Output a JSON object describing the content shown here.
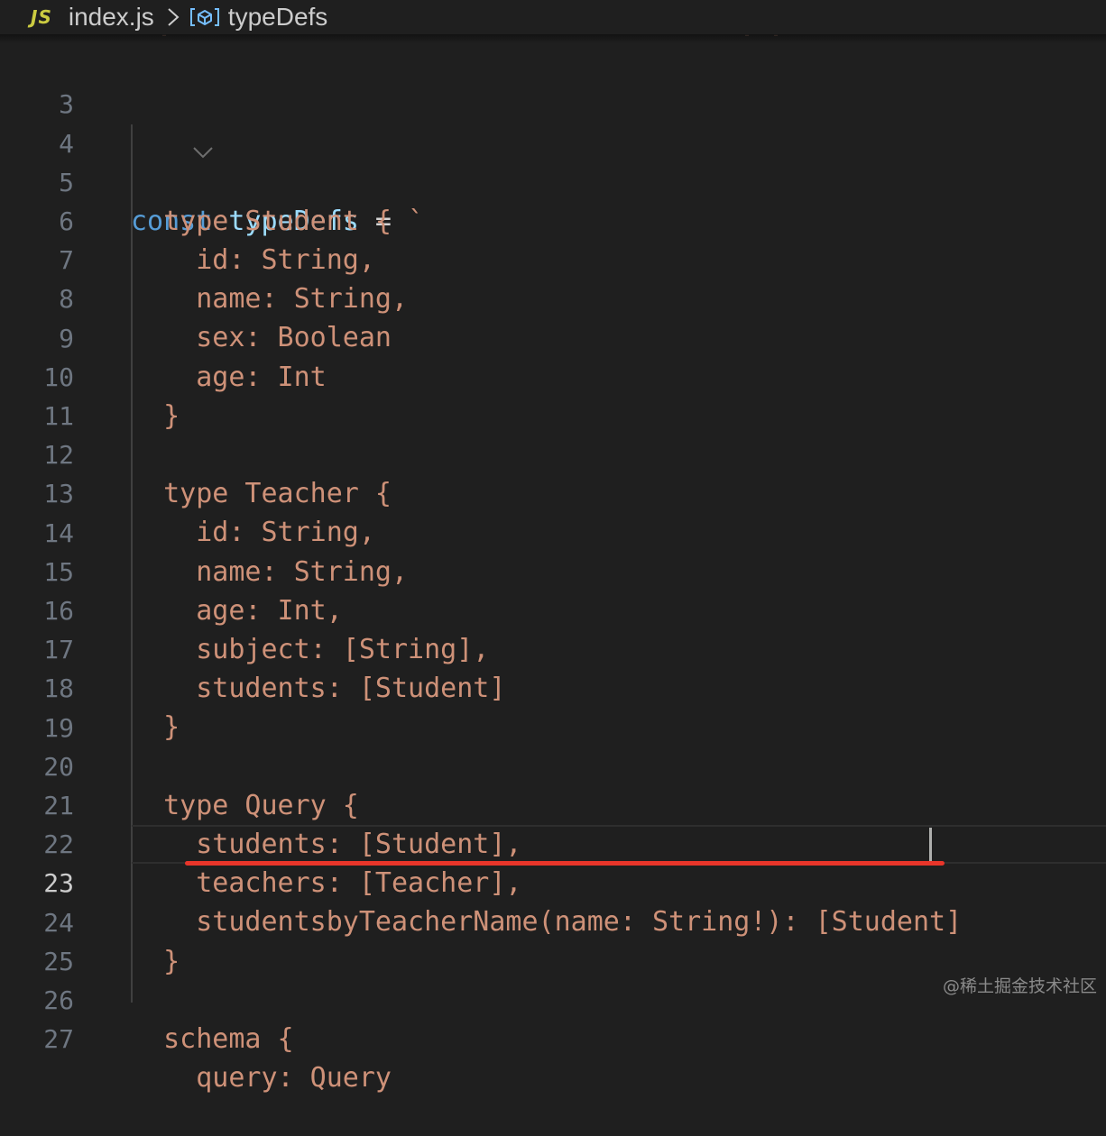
{
  "breadcrumb": {
    "file_badge": "JS",
    "file_name": "index.js",
    "symbol": "typeDefs",
    "chevron_icon": "chevron-right-icon",
    "symbol_icon": "variable-symbol-icon"
  },
  "editor": {
    "active_line": 23,
    "lines": [
      {
        "num": "3",
        "text": ""
      },
      {
        "num": "4",
        "kw": "const",
        "ident": "typeDefs",
        "op": " = ",
        "str": "`"
      },
      {
        "num": "5",
        "text": "  type Student {"
      },
      {
        "num": "6",
        "text": "    id: String,"
      },
      {
        "num": "7",
        "text": "    name: String,"
      },
      {
        "num": "8",
        "text": "    sex: Boolean"
      },
      {
        "num": "9",
        "text": "    age: Int"
      },
      {
        "num": "10",
        "text": "  }"
      },
      {
        "num": "11",
        "text": ""
      },
      {
        "num": "12",
        "text": "  type Teacher {"
      },
      {
        "num": "13",
        "text": "    id: String,"
      },
      {
        "num": "14",
        "text": "    name: String,"
      },
      {
        "num": "15",
        "text": "    age: Int,"
      },
      {
        "num": "16",
        "text": "    subject: [String],"
      },
      {
        "num": "17",
        "text": "    students: [Student]"
      },
      {
        "num": "18",
        "text": "  }"
      },
      {
        "num": "19",
        "text": ""
      },
      {
        "num": "20",
        "text": "  type Query {"
      },
      {
        "num": "21",
        "text": "    students: [Student],"
      },
      {
        "num": "22",
        "text": "    teachers: [Teacher],"
      },
      {
        "num": "23",
        "text": "    studentsbyTeacherName(name: String!): [Student]"
      },
      {
        "num": "24",
        "text": "  }"
      },
      {
        "num": "25",
        "text": ""
      },
      {
        "num": "26",
        "text": "  schema {"
      },
      {
        "num": "27",
        "text": "    query: Query"
      }
    ]
  },
  "watermark": "@稀土掘金技术社区",
  "colors": {
    "background": "#1f1f1f",
    "string": "#ce9178",
    "keyword": "#569cd6",
    "identifier": "#9cdcfe",
    "line_number": "#6e7681",
    "highlight_underline": "#e8352a",
    "js_badge": "#cbcb41"
  }
}
